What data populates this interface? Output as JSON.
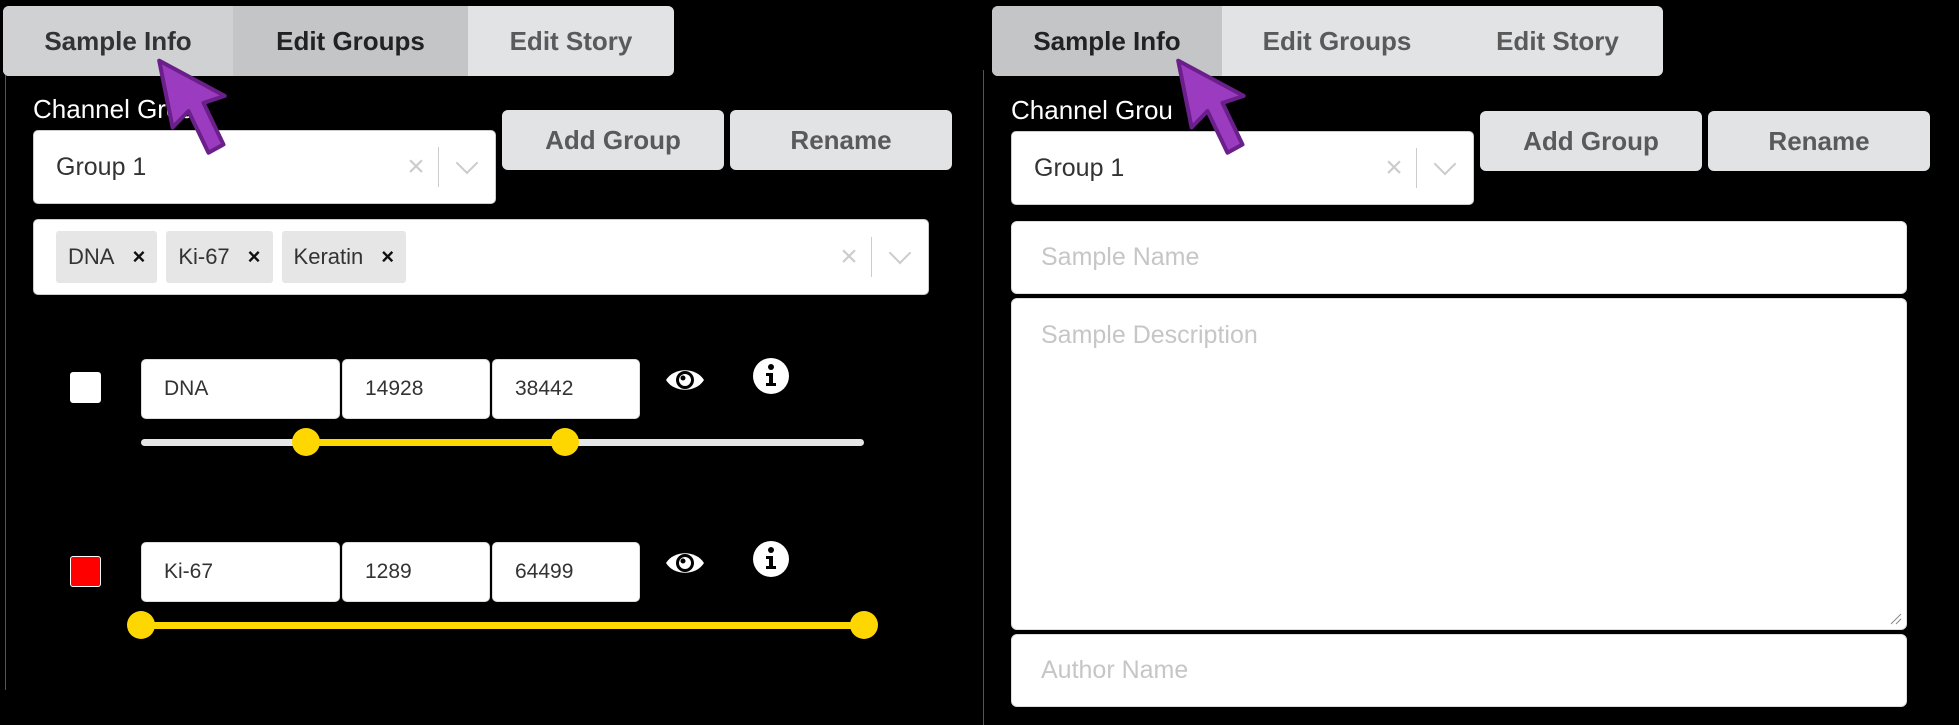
{
  "colors": {
    "accent_slider": "#ffd700",
    "cursor": "#9b3bbf",
    "background": "#000000"
  },
  "left_panel": {
    "tabs": [
      {
        "label": "Sample Info",
        "state": "hovered"
      },
      {
        "label": "Edit Groups",
        "state": "active"
      },
      {
        "label": "Edit Story",
        "state": "inactive"
      }
    ],
    "channel_group_label": "Channel Groups",
    "channel_group_visible_label": "Channel Grou",
    "group_select": {
      "value": "Group 1",
      "clear_icon": "clear-x-icon",
      "dropdown_icon": "chevron-down-icon"
    },
    "add_group_label": "Add Group",
    "rename_label": "Rename",
    "channel_select": {
      "chips": [
        {
          "label": "DNA",
          "remove": "×"
        },
        {
          "label": "Ki-67",
          "remove": "×"
        },
        {
          "label": "Keratin",
          "remove": "×"
        }
      ]
    },
    "channels": [
      {
        "name": "DNA",
        "min": "14928",
        "max": "38442",
        "color": "#ffffff",
        "range_lo_fraction": 0.228,
        "range_hi_fraction": 0.587,
        "visible_icon": "eye-icon",
        "info_icon": "info-icon"
      },
      {
        "name": "Ki-67",
        "min": "1289",
        "max": "64499",
        "color": "#ff0000",
        "range_lo_fraction": 0.0,
        "range_hi_fraction": 1.0,
        "visible_icon": "eye-icon",
        "info_icon": "info-icon"
      }
    ]
  },
  "right_panel": {
    "tabs": [
      {
        "label": "Sample Info",
        "state": "active"
      },
      {
        "label": "Edit Groups",
        "state": "inactive"
      },
      {
        "label": "Edit Story",
        "state": "inactive"
      }
    ],
    "channel_group_visible_label": "Channel Grou",
    "group_select": {
      "value": "Group 1"
    },
    "add_group_label": "Add Group",
    "rename_label": "Rename",
    "sample_name_placeholder": "Sample Name",
    "sample_description_placeholder": "Sample Description",
    "author_name_placeholder": "Author Name"
  }
}
